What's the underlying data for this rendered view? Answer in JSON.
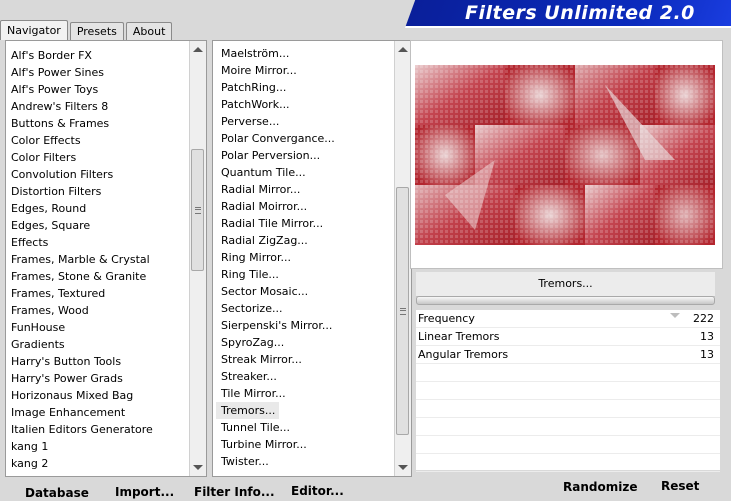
{
  "title": "Filters Unlimited 2.0",
  "tabs": [
    "Navigator",
    "Presets",
    "About"
  ],
  "categories": [
    "Alf's Border FX",
    "Alf's Power Sines",
    "Alf's Power Toys",
    "Andrew's Filters 8",
    "Buttons & Frames",
    "Color Effects",
    "Color Filters",
    "Convolution Filters",
    "Distortion Filters",
    "Edges, Round",
    "Edges, Square",
    "Effects",
    "Frames, Marble & Crystal",
    "Frames, Stone & Granite",
    "Frames, Textured",
    "Frames, Wood",
    "FunHouse",
    "Gradients",
    "Harry's Button Tools",
    "Harry's Power Grads",
    "Horizonaus Mixed Bag",
    "Image Enhancement",
    "Italien Editors Generatore",
    "kang 1",
    "kang 2"
  ],
  "filters": [
    "Maelström...",
    "Moire Mirror...",
    "PatchRing...",
    "PatchWork...",
    "Perverse...",
    "Polar Convergance...",
    "Polar Perversion...",
    "Quantum Tile...",
    "Radial Mirror...",
    "Radial Moirror...",
    "Radial Tile Mirror...",
    "Radial ZigZag...",
    "Ring Mirror...",
    "Ring Tile...",
    "Sector Mosaic...",
    "Sectorize...",
    "Sierpenski's Mirror...",
    "SpyroZag...",
    "Streak Mirror...",
    "Streaker...",
    "Tile Mirror...",
    "Tremors...",
    "Tunnel Tile...",
    "Turbine Mirror...",
    "Twister..."
  ],
  "selected_filter": "Tremors...",
  "params": [
    {
      "label": "Frequency",
      "value": "222"
    },
    {
      "label": "Linear Tremors",
      "value": "13"
    },
    {
      "label": "Angular Tremors",
      "value": "13"
    }
  ],
  "buttons": {
    "database": "Database",
    "import": "Import...",
    "filter_info": "Filter Info...",
    "editor": "Editor...",
    "randomize": "Randomize",
    "reset": "Reset"
  },
  "colors": {
    "banner": "#0b2bbd",
    "preview_red": "#b3262f",
    "preview_light": "#e8c6c8"
  }
}
